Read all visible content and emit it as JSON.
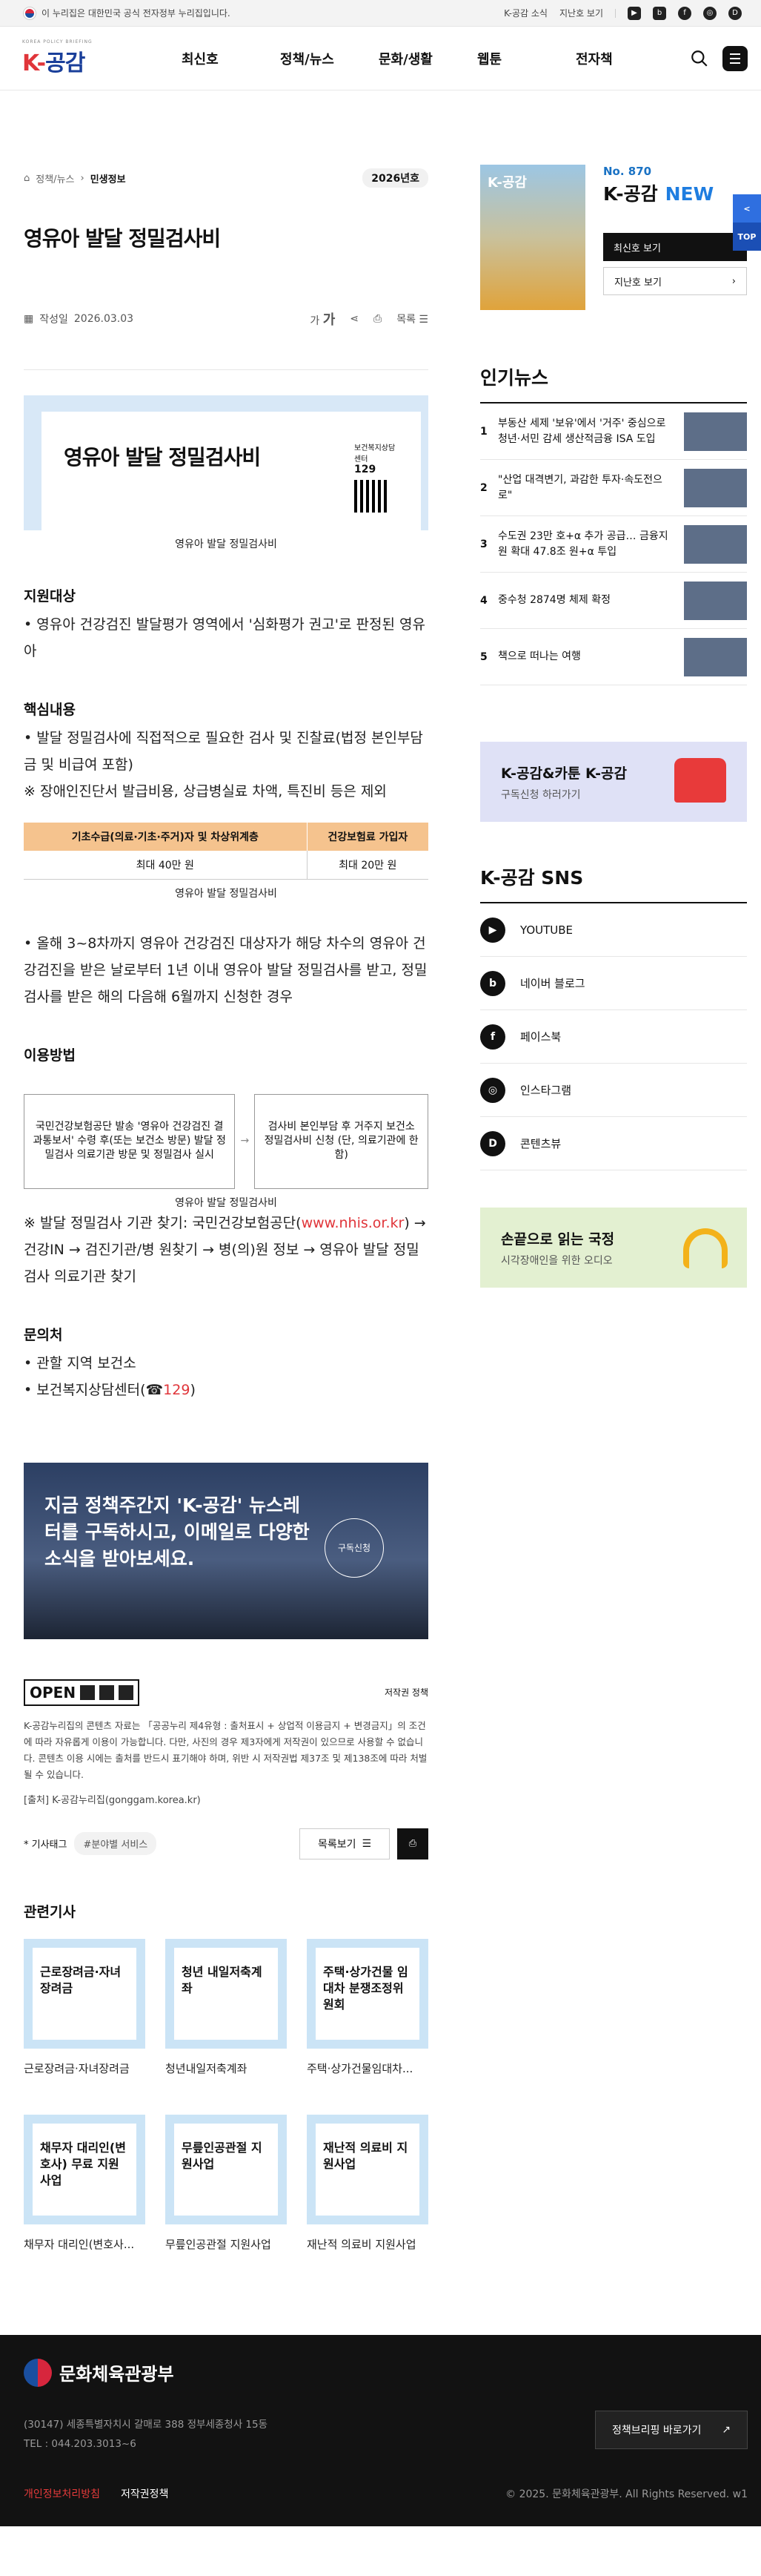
{
  "topbar": {
    "notice": "이 누리집은 대한민국 공식 전자정부 누리집입니다.",
    "links": [
      "K-공감 소식",
      "지난호 보기"
    ],
    "sns_icons": [
      "youtube-icon",
      "blog-icon",
      "facebook-icon",
      "instagram-icon",
      "contentview-icon"
    ]
  },
  "header": {
    "logo_sub": "KOREA POLICY BRIEFING",
    "logo_k": "K-",
    "logo_main": "공감",
    "nav": [
      "최신호",
      "정책/뉴스",
      "문화/생활",
      "웹툰",
      "전자책"
    ]
  },
  "article": {
    "breadcrumb": [
      "정책/뉴스",
      "민생정보"
    ],
    "issue": "2026년호",
    "title": "영유아 발달 정밀검사비",
    "date_label": "작성일",
    "date": "2026.03.03",
    "font_label": "가",
    "font_label2": "가",
    "list_label": "목록",
    "banner_title": "영유아 발달 정밀검사비",
    "banner_org": "보건복지상담센터",
    "banner_num": "129",
    "banner_caption": "영유아 발달 정밀검사비",
    "sec1_h": "지원대상",
    "sec1_p": "• 영유아 건강검진 발달평가 영역에서 '심화평가 권고'로 판정된 영유아",
    "sec2_h": "핵심내용",
    "sec2_p1": "• 발달 정밀검사에 직접적으로 필요한 검사 및 진찰료(법정 본인부담금 및 비급여 포함)",
    "sec2_p2": "※ 장애인진단서 발급비용, 상급병실료 차액, 특진비 등은 제외",
    "table": {
      "headers": [
        "기초수급(의료·기초·주거)자 및 차상위계층",
        "건강보험료 가입자"
      ],
      "cells": [
        "최대 40만 원",
        "최대 20만 원"
      ]
    },
    "table_caption": "영유아 발달 정밀검사비",
    "sec2_p3": "• 올해 3~8차까지 영유아 건강검진 대상자가 해당 차수의 영유아 건강검진을 받은 날로부터 1년 이내 영유아 발달 정밀검사를 받고, 정밀검사를 받은 해의 다음해 6월까지 신청한 경우",
    "sec3_h": "이용방법",
    "flow_a": "국민건강보험공단 발송 '영유아 건강검진 결과통보서' 수령 후(또는 보건소 방문) 발달 정밀검사 의료기관 방문 및 정밀검사 실시",
    "flow_b": "검사비 본인부담 후 거주지 보건소 정밀검사비 신청 (단, 의료기관에 한함)",
    "flow_caption": "영유아 발달 정밀검사비",
    "sec3_p_pre": "※ 발달 정밀검사 기관 찾기: 국민건강보험공단(",
    "sec3_link": "www.nhis.or.kr",
    "sec3_p_post": ") → 건강IN → 검진기관/병 원찾기 → 병(의)원 정보 → 영유아 발달 정밀검사 의료기관 찾기",
    "sec4_h": "문의처",
    "sec4_p1": "• 관할 지역 보건소",
    "sec4_p2_pre": "• 보건복지상담센터(☎",
    "sec4_p2_num": "129",
    "sec4_p2_post": ")",
    "newsletter": "지금 정책주간지 'K-공감' 뉴스레터를 구독하시고, 이메일로 다양한 소식을 받아보세요.",
    "newsletter_btn": "구독신청",
    "license_label": "OPEN",
    "license_policy": "저작권 정책",
    "license_text": "K-공감누리집의 콘텐츠 자료는 「공공누리 제4유형 : 출처표시 + 상업적 이용금지 + 변경금지」의 조건에 따라 자유롭게 이용이 가능합니다. 다만, 사진의 경우 제3자에게 저작권이 있으므로 사용할 수 없습니다. 콘텐츠 이용 시에는 출처를 반드시 표기해야 하며, 위반 시 저작권법 제37조 및 제138조에 따라 처벌될 수 있습니다.",
    "source": "[출처] K-공감누리집(gonggam.korea.kr)",
    "tag_label": "* 기사태그",
    "tag": "#분야별 서비스",
    "list_btn": "목록보기"
  },
  "related": {
    "heading": "관련기사",
    "items": [
      {
        "thumb": "근로장려금·자녀장려금",
        "title": "근로장려금·자녀장려금"
      },
      {
        "thumb": "청년 내일저축계좌",
        "title": "청년내일저축계좌"
      },
      {
        "thumb": "주택·상가건물 임대차 분쟁조정위원회",
        "title": "주택·상가건물임대차..."
      },
      {
        "thumb": "채무자 대리인(변호사) 무료 지원사업",
        "title": "채무자 대리인(변호사..."
      },
      {
        "thumb": "무릎인공관절 지원사업",
        "title": "무릎인공관절 지원사업"
      },
      {
        "thumb": "재난적 의료비 지원사업",
        "title": "재난적 의료비 지원사업"
      }
    ]
  },
  "aside": {
    "cover_label": "K-공감",
    "no": "No. 870",
    "name": "K-공감",
    "new": "NEW",
    "btn_latest": "최신호 보기",
    "btn_past": "지난호 보기",
    "popular_h": "인기뉴스",
    "popular": [
      "부동산 세제 '보유'에서 '거주' 중심으로 청년·서민 감세 생산적금융 ISA 도입",
      "\"산업 대격변기, 과감한 투자·속도전으로\"",
      "수도권 23만 호+α 추가 공급… 금융지원 확대 47.8조 원+α 투입",
      "중수청 2874명 체제 확정",
      "책으로 떠나는 여행"
    ],
    "promo_h": "K-공감&카툰 K-공감",
    "promo_p": "구독신청 하러가기",
    "sns_h": "K-공감 SNS",
    "sns": [
      {
        "icon": "youtube-icon",
        "label": "YOUTUBE",
        "glyph": "▶"
      },
      {
        "icon": "blog-icon",
        "label": "네이버 블로그",
        "glyph": "b"
      },
      {
        "icon": "facebook-icon",
        "label": "페이스북",
        "glyph": "f"
      },
      {
        "icon": "instagram-icon",
        "label": "인스타그램",
        "glyph": "◎"
      },
      {
        "icon": "contentview-icon",
        "label": "콘텐츠뷰",
        "glyph": "D"
      }
    ],
    "promo2_h": "손끝으로 읽는 국정",
    "promo2_p": "시각장애인을 위한 오디오"
  },
  "fixed": {
    "share": "<",
    "top": "TOP"
  },
  "footer": {
    "org": "문화체육관광부",
    "addr": "(30147) 세종특별자치시 갈매로 388 정부세종청사 15동",
    "tel": "TEL : 044.203.3013~6",
    "brief_btn": "정책브리핑 바로가기",
    "privacy": "개인정보처리방침",
    "copyright_policy": "저작권정책",
    "copyright": "© 2025. 문화체육관광부. All Rights Reserved. w1"
  },
  "colors": {
    "accent": "#1a3f9a",
    "red": "#e0353a",
    "orange": "#f5c38e"
  }
}
